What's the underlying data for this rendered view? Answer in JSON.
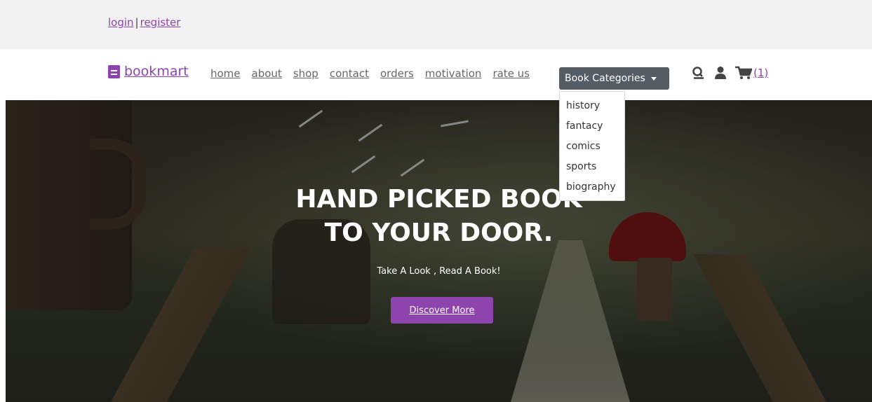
{
  "topbar": {
    "login": "login",
    "separator": "|",
    "register": "register"
  },
  "navbar": {
    "logo": "bookmart",
    "links": [
      "home",
      "about",
      "shop",
      "contact",
      "orders",
      "motivation",
      "rate us"
    ],
    "categories_button": "Book Categories",
    "cart_count": "(1)",
    "icons": [
      "search-icon",
      "user-icon",
      "cart-icon"
    ]
  },
  "dropdown": {
    "items": [
      "history",
      "fantacy",
      "comics",
      "sports",
      "biography"
    ]
  },
  "hero": {
    "title_line1": "HAND PICKED BOOK",
    "title_line2": "TO YOUR DOOR.",
    "subtitle": "Take A Look , Read A Book!",
    "button": "Discover More"
  },
  "colors": {
    "brand": "#8e44ad",
    "category_button": "#545c64",
    "topbar_bg": "#f3f2f3"
  }
}
